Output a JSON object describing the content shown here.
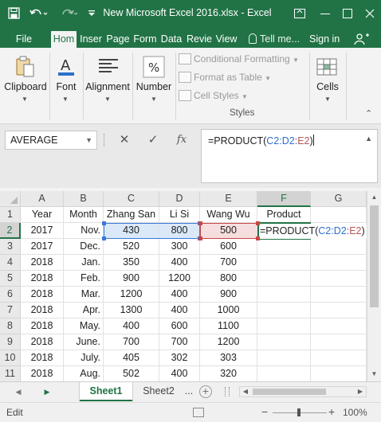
{
  "titlebar": {
    "title": "New Microsoft Excel 2016.xlsx - Excel",
    "save_icon": "save-icon",
    "undo_icon": "undo-icon",
    "redo_icon": "redo-icon",
    "customize_icon": "customize-qat-icon"
  },
  "tabs": {
    "items": [
      "File",
      "Hom",
      "Inser",
      "Page",
      "Form",
      "Data",
      "Revie",
      "View"
    ],
    "active": "Hom",
    "tell_me": "Tell me...",
    "sign_in": "Sign in"
  },
  "ribbon": {
    "clipboard": "Clipboard",
    "font": "Font",
    "alignment": "Alignment",
    "number": "Number",
    "cells": "Cells",
    "conditional_formatting": "Conditional Formatting",
    "format_as_table": "Format as Table",
    "cell_styles": "Cell Styles",
    "styles_label": "Styles",
    "number_symbol": "%",
    "font_symbol": "A"
  },
  "formula_bar": {
    "name_box": "AVERAGE",
    "cancel_symbol": "✕",
    "enter_symbol": "✓",
    "fx_symbol": "fx",
    "formula_parts": [
      "=PRODUCT(",
      "C2:D2:",
      "E2",
      ")"
    ]
  },
  "grid": {
    "columns": [
      "A",
      "B",
      "C",
      "D",
      "E",
      "F",
      "G"
    ],
    "active_column": "F",
    "active_row": "2",
    "rows": [
      {
        "num": "1",
        "cells": [
          "Year",
          "Month",
          "Zhang San",
          "Li Si",
          "Wang Wu",
          "Product",
          ""
        ]
      },
      {
        "num": "2",
        "cells": [
          "2017",
          "Nov.",
          "430",
          "800",
          "500",
          "",
          ""
        ]
      },
      {
        "num": "3",
        "cells": [
          "2017",
          "Dec.",
          "520",
          "300",
          "600",
          "",
          ""
        ]
      },
      {
        "num": "4",
        "cells": [
          "2018",
          "Jan.",
          "350",
          "400",
          "700",
          "",
          ""
        ]
      },
      {
        "num": "5",
        "cells": [
          "2018",
          "Feb.",
          "900",
          "1200",
          "800",
          "",
          ""
        ]
      },
      {
        "num": "6",
        "cells": [
          "2018",
          "Mar.",
          "1200",
          "400",
          "900",
          "",
          ""
        ]
      },
      {
        "num": "7",
        "cells": [
          "2018",
          "Apr.",
          "1300",
          "400",
          "1000",
          "",
          ""
        ]
      },
      {
        "num": "8",
        "cells": [
          "2018",
          "May.",
          "400",
          "600",
          "1100",
          "",
          ""
        ]
      },
      {
        "num": "9",
        "cells": [
          "2018",
          "June.",
          "700",
          "700",
          "1200",
          "",
          ""
        ]
      },
      {
        "num": "10",
        "cells": [
          "2018",
          "July.",
          "405",
          "302",
          "303",
          "",
          ""
        ]
      },
      {
        "num": "11",
        "cells": [
          "2018",
          "Aug.",
          "502",
          "400",
          "320",
          "",
          ""
        ]
      }
    ],
    "editing_cell_parts": [
      "=PRODUCT(",
      "C2:D2:",
      "E2",
      ")"
    ]
  },
  "sheets": {
    "tabs": [
      "Sheet1",
      "Sheet2"
    ],
    "active": "Sheet1",
    "more": "...",
    "add_symbol": "+"
  },
  "status": {
    "mode": "Edit",
    "zoom": "100%",
    "zoom_minus": "−",
    "zoom_plus": "+"
  },
  "colors": {
    "accent": "#217346",
    "ref_blue": "#2e6fcd",
    "ref_red": "#b45555"
  }
}
